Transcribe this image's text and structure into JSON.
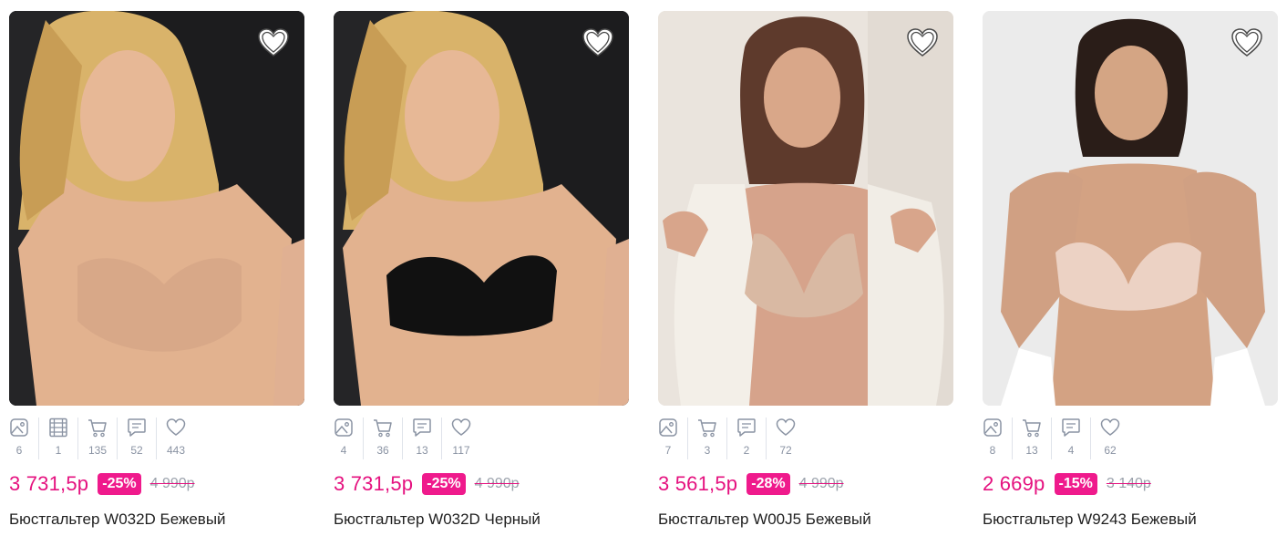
{
  "colors": {
    "price": "#e5117f",
    "discount_bg": "#ef1a8c",
    "old_price": "#9aa1ab",
    "icon": "#8a93a3"
  },
  "products": [
    {
      "stats": [
        {
          "icon": "photo-icon",
          "count": "6"
        },
        {
          "icon": "video-icon",
          "count": "1"
        },
        {
          "icon": "cart-icon",
          "count": "135"
        },
        {
          "icon": "comment-icon",
          "count": "52"
        },
        {
          "icon": "heart-icon",
          "count": "443"
        }
      ],
      "price": "3 731,5р",
      "discount": "-25%",
      "old_price": "4 990р",
      "title": "Бюстгальтер W032D Бежевый"
    },
    {
      "stats": [
        {
          "icon": "photo-icon",
          "count": "4"
        },
        {
          "icon": "cart-icon",
          "count": "36"
        },
        {
          "icon": "comment-icon",
          "count": "13"
        },
        {
          "icon": "heart-icon",
          "count": "117"
        }
      ],
      "price": "3 731,5р",
      "discount": "-25%",
      "old_price": "4 990р",
      "title": "Бюстгальтер W032D Черный"
    },
    {
      "stats": [
        {
          "icon": "photo-icon",
          "count": "7"
        },
        {
          "icon": "cart-icon",
          "count": "3"
        },
        {
          "icon": "comment-icon",
          "count": "2"
        },
        {
          "icon": "heart-icon",
          "count": "72"
        }
      ],
      "price": "3 561,5р",
      "discount": "-28%",
      "old_price": "4 990р",
      "title": "Бюстгальтер W00J5 Бежевый"
    },
    {
      "stats": [
        {
          "icon": "photo-icon",
          "count": "8"
        },
        {
          "icon": "cart-icon",
          "count": "13"
        },
        {
          "icon": "comment-icon",
          "count": "4"
        },
        {
          "icon": "heart-icon",
          "count": "62"
        }
      ],
      "price": "2 669р",
      "discount": "-15%",
      "old_price": "3 140р",
      "title": "Бюстгальтер W9243 Бежевый"
    }
  ]
}
